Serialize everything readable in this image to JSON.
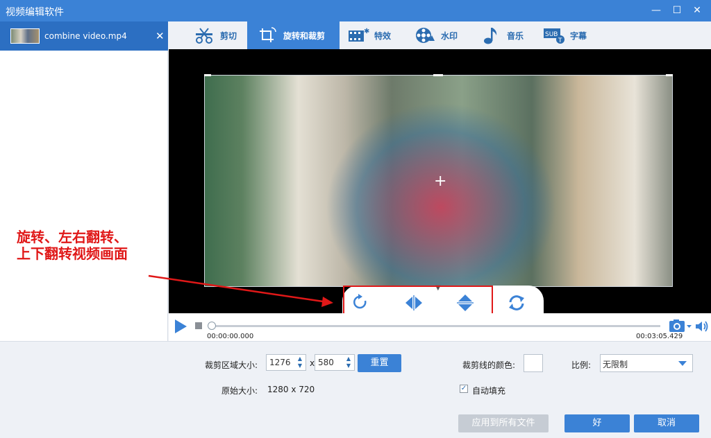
{
  "window": {
    "title": "视频编辑软件"
  },
  "file": {
    "name": "combine video.mp4"
  },
  "tabs": [
    {
      "label": "剪切"
    },
    {
      "label": "旋转和裁剪"
    },
    {
      "label": "特效"
    },
    {
      "label": "水印"
    },
    {
      "label": "音乐"
    },
    {
      "label": "字幕"
    }
  ],
  "annotation": {
    "line1": "旋转、左右翻转、",
    "line2": "上下翻转视频画面"
  },
  "player": {
    "time_start": "00:00:00.000",
    "time_end": "00:03:05.429",
    "progress": 0
  },
  "crop": {
    "area_label": "裁剪区域大小:",
    "width": "1276",
    "height": "580",
    "times": "x",
    "reset_label": "重置",
    "original_label": "原始大小:",
    "original_value": "1280 x 720",
    "line_color_label": "裁剪线的颜色:",
    "ratio_label": "比例:",
    "ratio_value": "无限制",
    "autofill_label": "自动填充",
    "autofill_checked": true
  },
  "actions": {
    "apply_all": "应用到所有文件",
    "ok": "好",
    "cancel": "取消"
  },
  "colors": {
    "accent": "#3b82d6",
    "annotation": "#e01818"
  }
}
